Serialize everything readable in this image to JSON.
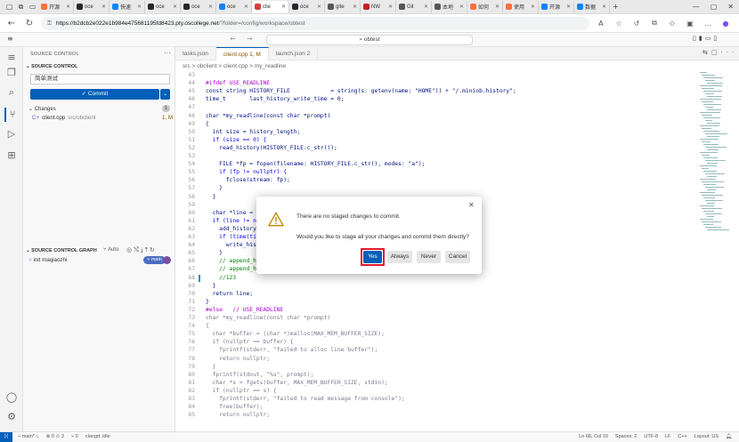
{
  "browser": {
    "tabs": [
      {
        "label": "开源",
        "color": "#ff6f3a"
      },
      {
        "label": "oce",
        "color": "#24292e"
      },
      {
        "label": "快速",
        "color": "#0a84ff"
      },
      {
        "label": "oce",
        "color": "#24292e"
      },
      {
        "label": "oce",
        "color": "#24292e"
      },
      {
        "label": "oce",
        "color": "#0a84ff"
      },
      {
        "label": "clie",
        "color": "#d43f3a",
        "active": true
      },
      {
        "label": "oce",
        "color": "#24292e"
      },
      {
        "label": "gite",
        "color": "#555555"
      },
      {
        "label": "NW",
        "color": "#c71d23"
      },
      {
        "label": "Git",
        "color": "#555555"
      },
      {
        "label": "本地",
        "color": "#555555"
      },
      {
        "label": "如何",
        "color": "#ff6f3a"
      },
      {
        "label": "使用",
        "color": "#ff6f3a"
      },
      {
        "label": "开源",
        "color": "#0a84ff"
      },
      {
        "label": "数据",
        "color": "#0a84ff"
      }
    ],
    "url_host": "https://b2dcb2e022e1b984e475681195fd8423.pty.oscollege.net",
    "url_path": "/?folder=/config/workspace/obtest"
  },
  "vscode": {
    "command_center": "obtest",
    "sidebar": {
      "title": "SOURCE CONTROL",
      "section": "SOURCE CONTROL",
      "message_value": "简单测试",
      "commit_label": "✓ Commit",
      "changes_label": "Changes",
      "changes_count": "1",
      "changed_file": "client.cpp",
      "changed_path": "src/obclient",
      "changed_status": "1, M",
      "graph_title": "SOURCE CONTROL GRAPH",
      "graph_auto": "Auto",
      "graph_commit": "init maqiaozhi",
      "graph_branch": "main"
    },
    "tabs": [
      {
        "label": "tasks.json",
        "active": false
      },
      {
        "label": "client.cpp 1, M",
        "active": true
      },
      {
        "label": "launch.json 2",
        "active": false
      }
    ],
    "breadcrumb": "src > obclient > client.cpp > my_readline",
    "code": [
      {
        "n": "43",
        "t": "",
        "c": ""
      },
      {
        "n": "44",
        "t": "#ifdef USE_READLINE",
        "c": "pp"
      },
      {
        "n": "45",
        "t": "const string HISTORY_FILE            = string(s: getenv(name: \"HOME\")) + \"/.miniob.history\";",
        "c": ""
      },
      {
        "n": "46",
        "t": "time_t       last_history_write_time = 0;",
        "c": ""
      },
      {
        "n": "47",
        "t": "",
        "c": ""
      },
      {
        "n": "48",
        "t": "char *my_readline(const char *prompt)",
        "c": ""
      },
      {
        "n": "49",
        "t": "{",
        "c": ""
      },
      {
        "n": "50",
        "t": "  int size = history_length;",
        "c": ""
      },
      {
        "n": "51",
        "t": "  if (size == 0) {",
        "c": "kw"
      },
      {
        "n": "52",
        "t": "    read_history(HISTORY_FILE.c_str());",
        "c": ""
      },
      {
        "n": "53",
        "t": "",
        "c": ""
      },
      {
        "n": "54",
        "t": "    FILE *fp = fopen(filename: HISTORY_FILE.c_str(), modes: \"a\");",
        "c": ""
      },
      {
        "n": "55",
        "t": "    if (fp != nullptr) {",
        "c": "kw"
      },
      {
        "n": "56",
        "t": "      fclose(stream: fp);",
        "c": ""
      },
      {
        "n": "57",
        "t": "    }",
        "c": ""
      },
      {
        "n": "58",
        "t": "  }",
        "c": ""
      },
      {
        "n": "59",
        "t": "",
        "c": ""
      },
      {
        "n": "60",
        "t": "  char *line = r",
        "c": ""
      },
      {
        "n": "61",
        "t": "  if (line != n",
        "c": "kw"
      },
      {
        "n": "62",
        "t": "    add_history",
        "c": ""
      },
      {
        "n": "63",
        "t": "    if (time(ti",
        "c": "kw"
      },
      {
        "n": "64",
        "t": "      write_his",
        "c": ""
      },
      {
        "n": "65",
        "t": "    }",
        "c": ""
      },
      {
        "n": "66",
        "t": "    // append_h",
        "c": "cm"
      },
      {
        "n": "67",
        "t": "    // append_h",
        "c": "cm"
      },
      {
        "n": "68",
        "t": "    //123",
        "c": "cm"
      },
      {
        "n": "69",
        "t": "  }",
        "c": ""
      },
      {
        "n": "70",
        "t": "  return line;",
        "c": ""
      },
      {
        "n": "71",
        "t": "}",
        "c": ""
      },
      {
        "n": "72",
        "t": "#else   // USE_READLINE",
        "c": "pp"
      },
      {
        "n": "73",
        "t": "char *my_readline(const char *prompt)",
        "c": "dim"
      },
      {
        "n": "74",
        "t": "{",
        "c": "dim"
      },
      {
        "n": "75",
        "t": "  char *buffer = (char *)malloc(MAX_MEM_BUFFER_SIZE);",
        "c": "dim"
      },
      {
        "n": "76",
        "t": "  if (nullptr == buffer) {",
        "c": "dim"
      },
      {
        "n": "77",
        "t": "    fprintf(stderr, \"failed to alloc line buffer\");",
        "c": "dim"
      },
      {
        "n": "78",
        "t": "    return nullptr;",
        "c": "dim"
      },
      {
        "n": "79",
        "t": "  }",
        "c": "dim"
      },
      {
        "n": "80",
        "t": "  fprintf(stdout, \"%s\", prompt);",
        "c": "dim"
      },
      {
        "n": "81",
        "t": "  char *s = fgets(buffer, MAX_MEM_BUFFER_SIZE, stdin);",
        "c": "dim"
      },
      {
        "n": "82",
        "t": "  if (nullptr == s) {",
        "c": "dim"
      },
      {
        "n": "83",
        "t": "    fprintf(stderr, \"failed to read message from console\");",
        "c": "dim"
      },
      {
        "n": "84",
        "t": "    free(buffer);",
        "c": "dim"
      },
      {
        "n": "85",
        "t": "    return nullptr;",
        "c": "dim"
      }
    ],
    "status": {
      "branch": "main*",
      "problems": "⊗ 0 ⚠ 3",
      "ports": "0",
      "clangd": "clangd: idle",
      "position": "Ln 68, Col 10",
      "spaces": "Spaces: 2",
      "encoding": "UTF-8",
      "eol": "LF",
      "lang": "C++",
      "layout": "Layout: US"
    }
  },
  "dialog": {
    "message": "There are no staged changes to commit.",
    "detail": "Would you like to stage all your changes and commit them directly?",
    "yes": "Yes",
    "always": "Always",
    "never": "Never",
    "cancel": "Cancel"
  }
}
